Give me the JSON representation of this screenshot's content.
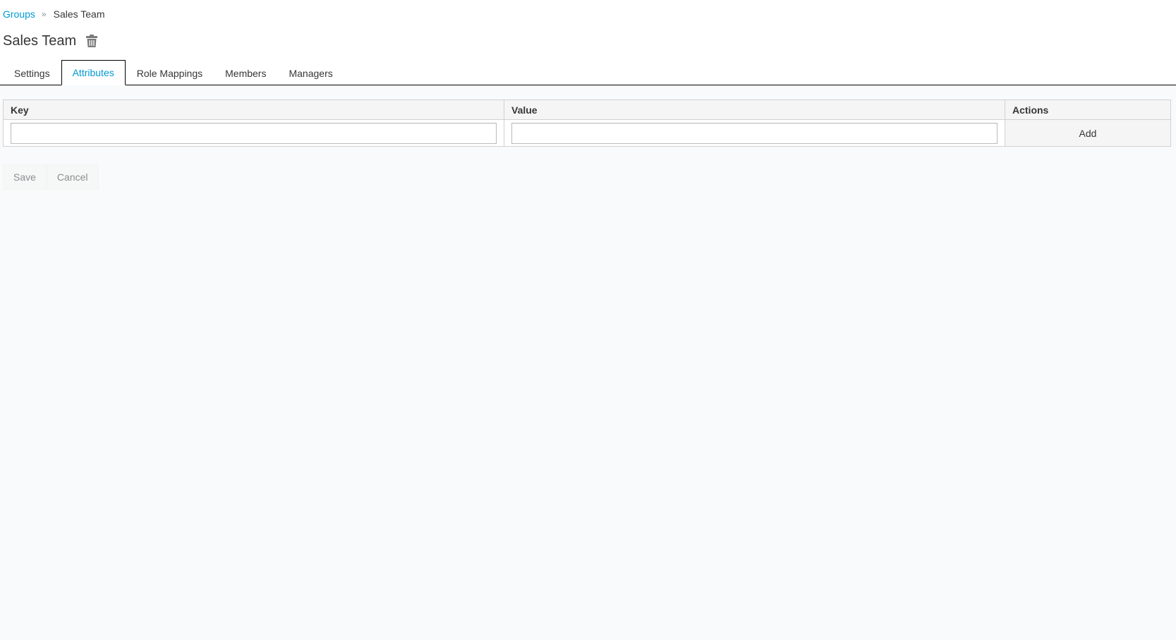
{
  "breadcrumb": {
    "parent": "Groups",
    "separator": "»",
    "current": "Sales Team"
  },
  "header": {
    "title": "Sales Team",
    "delete_icon": "trash-icon"
  },
  "tabs": [
    {
      "label": "Settings",
      "active": false
    },
    {
      "label": "Attributes",
      "active": true
    },
    {
      "label": "Role Mappings",
      "active": false
    },
    {
      "label": "Members",
      "active": false
    },
    {
      "label": "Managers",
      "active": false
    }
  ],
  "attributes_table": {
    "columns": [
      "Key",
      "Value",
      "Actions"
    ],
    "new_row": {
      "key_value": "",
      "value_value": "",
      "add_label": "Add"
    }
  },
  "form": {
    "save_label": "Save",
    "cancel_label": "Cancel"
  },
  "colors": {
    "link": "#0099d3",
    "text": "#363636",
    "muted": "#8b8d8f",
    "page_bg": "#f9fafb",
    "border": "#d1d1d1"
  }
}
